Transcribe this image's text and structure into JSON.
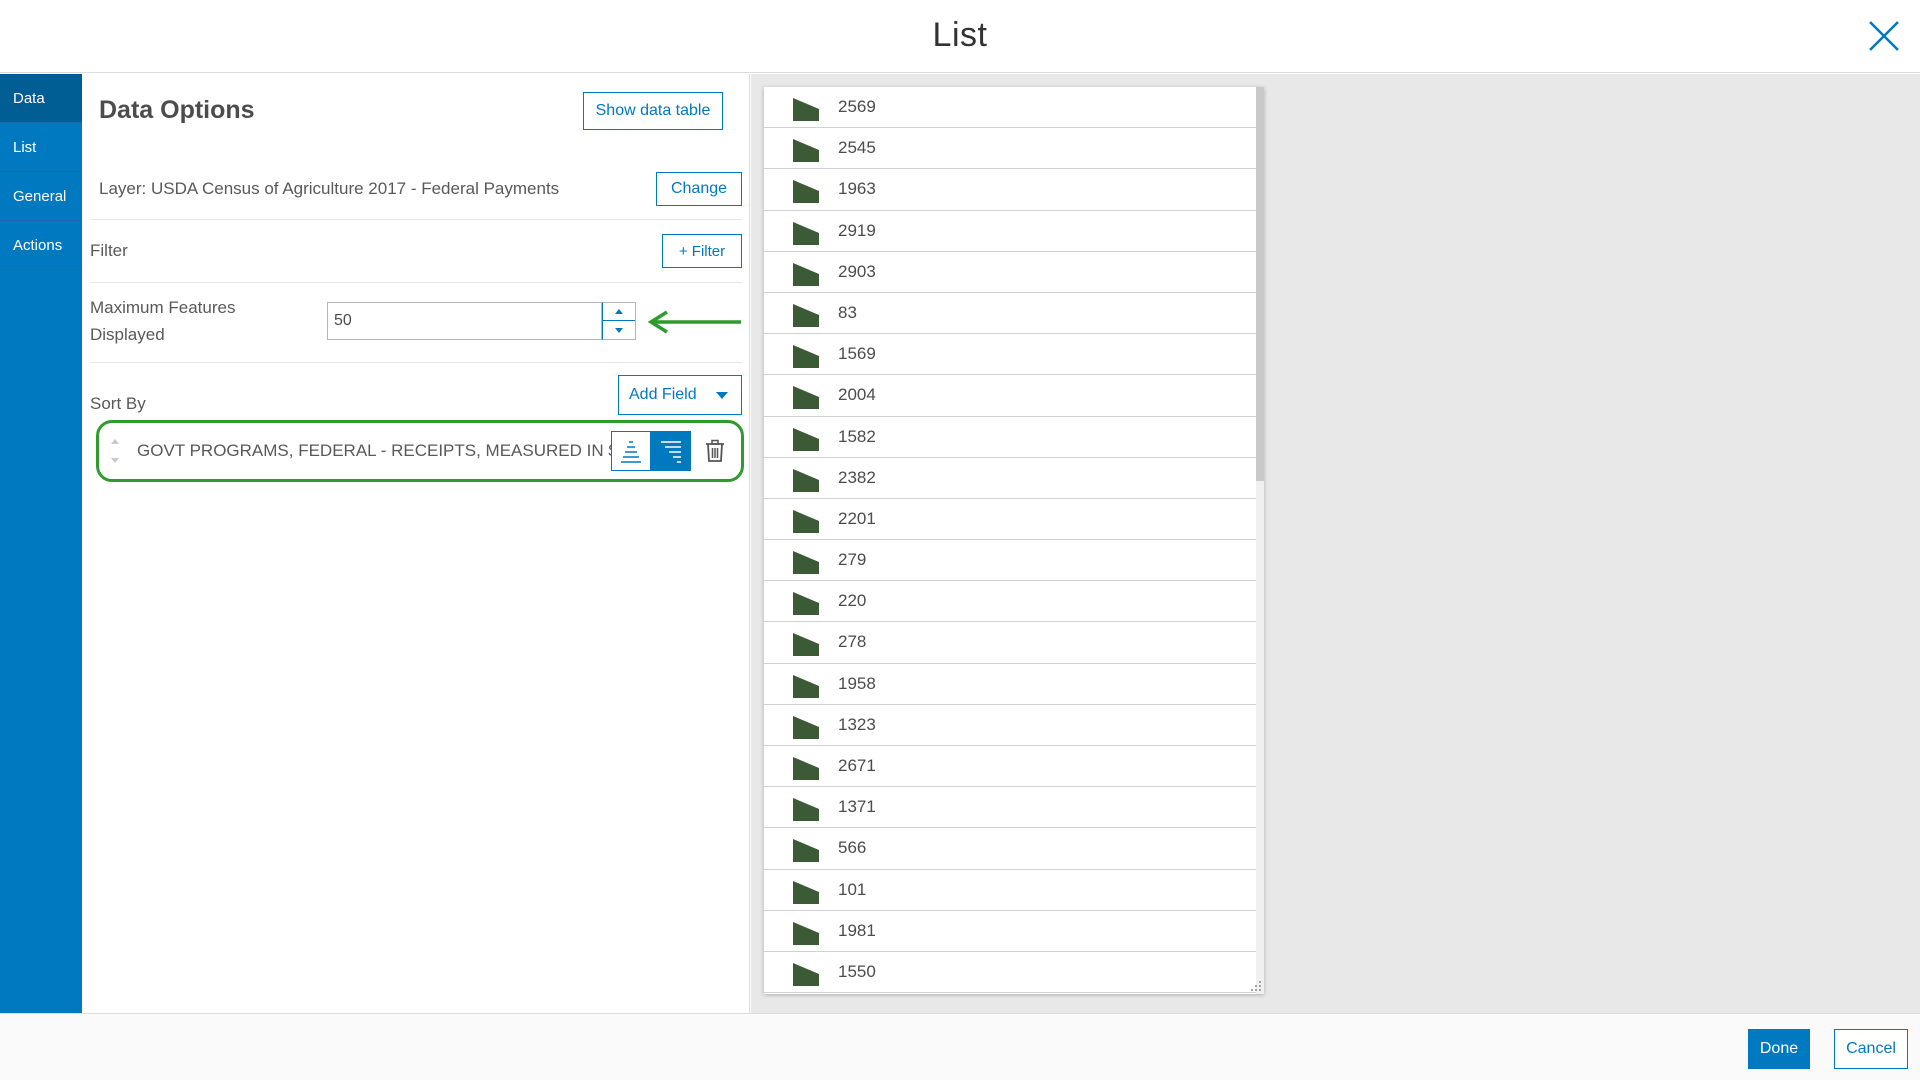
{
  "header": {
    "title": "List"
  },
  "sidebar": {
    "tabs": [
      {
        "label": "Data"
      },
      {
        "label": "List"
      },
      {
        "label": "General"
      },
      {
        "label": "Actions"
      }
    ]
  },
  "data_options": {
    "title": "Data Options",
    "show_table_label": "Show data table",
    "layer_text": "Layer: USDA Census of Agriculture 2017 - Federal Payments",
    "change_label": "Change",
    "filter_label": "Filter",
    "add_filter_label": "+ Filter",
    "max_features_label_1": "Maximum Features",
    "max_features_label_2": "Displayed",
    "max_features_value": "50",
    "sort_by_label": "Sort By",
    "add_field_label": "Add Field",
    "sort_field": "GOVT PROGRAMS, FEDERAL - RECEIPTS, MEASURED IN $"
  },
  "preview": {
    "items": [
      "2569",
      "2545",
      "1963",
      "2919",
      "2903",
      "83",
      "1569",
      "2004",
      "1582",
      "2382",
      "2201",
      "279",
      "220",
      "278",
      "1958",
      "1323",
      "2671",
      "1371",
      "566",
      "101",
      "1981",
      "1550"
    ]
  },
  "footer": {
    "done_label": "Done",
    "cancel_label": "Cancel"
  },
  "colors": {
    "accent": "#0079c1",
    "highlight": "#2e9b2e",
    "symbol": "#3d5a36"
  }
}
